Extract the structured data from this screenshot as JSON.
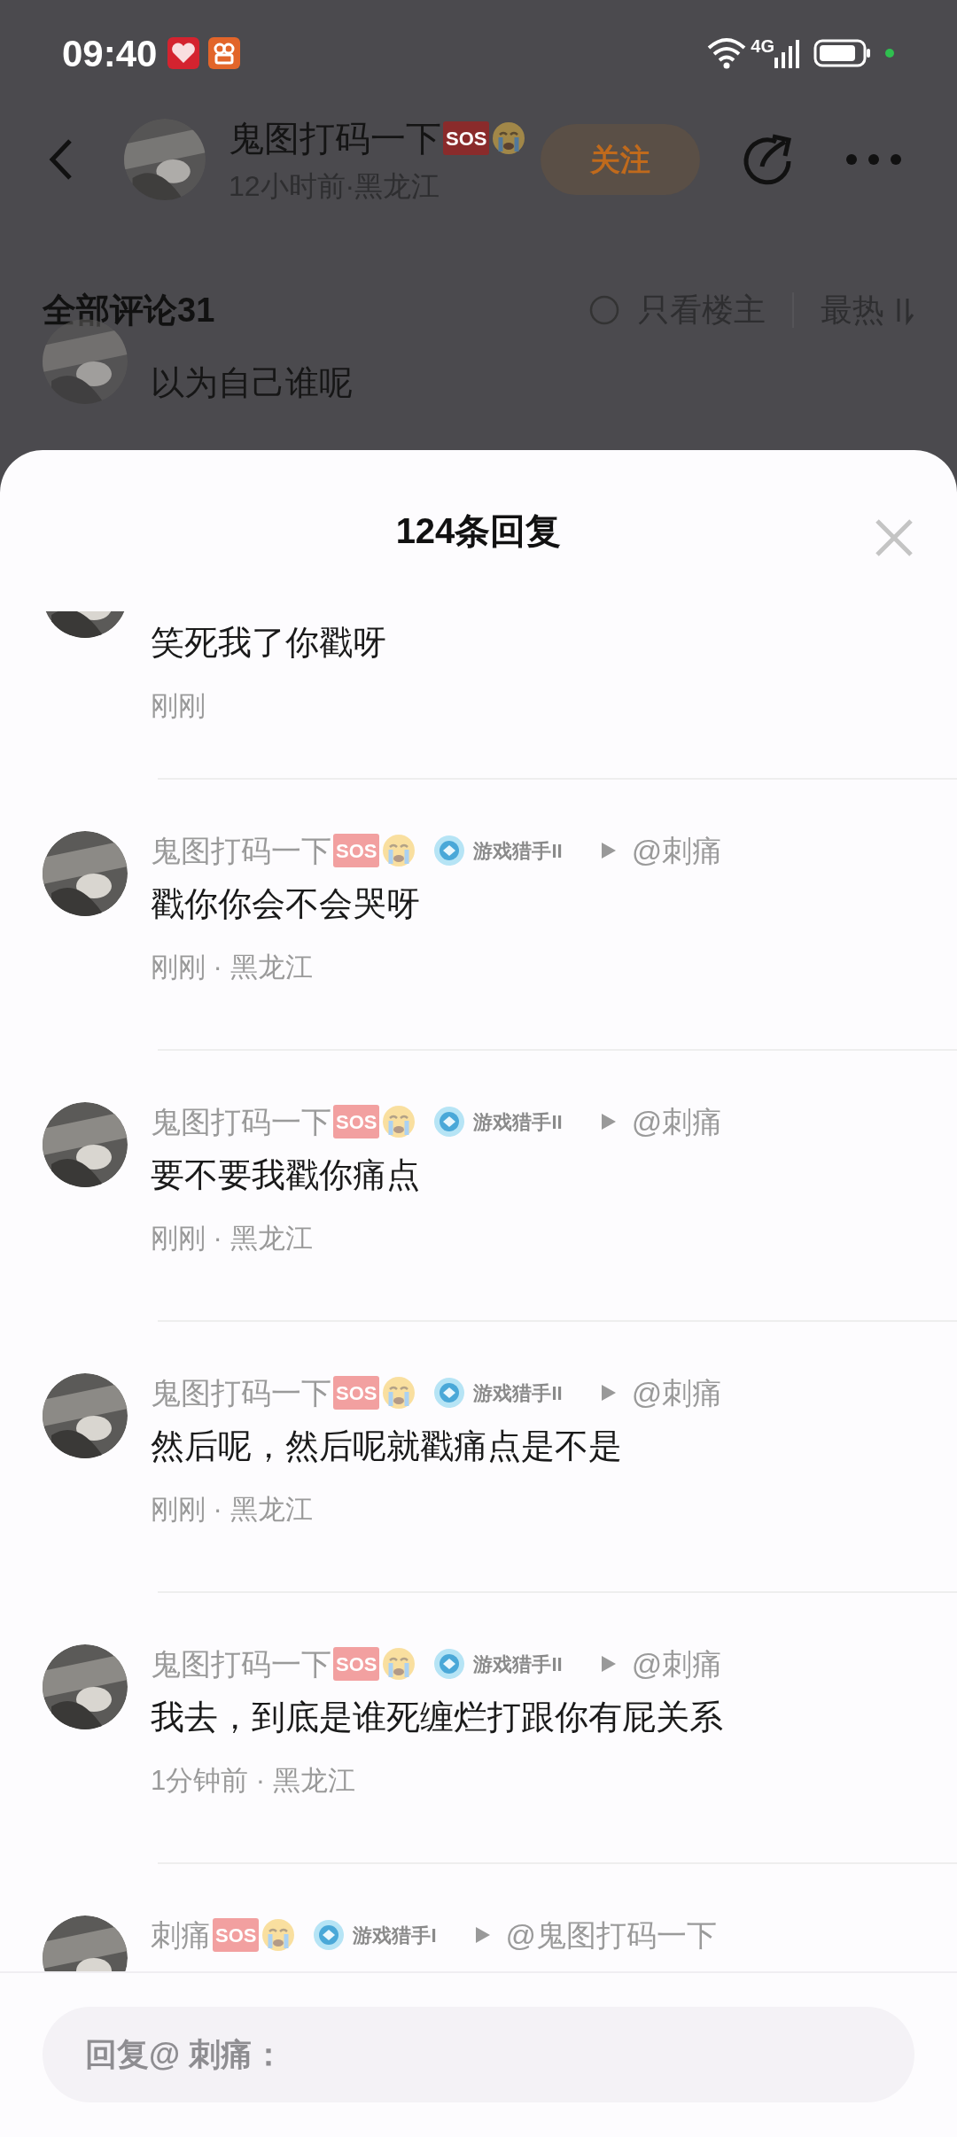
{
  "status_bar": {
    "time": "09:40",
    "network": "4G"
  },
  "post_header": {
    "author": "鬼图打码一下",
    "sos": "SOS",
    "meta": "12小时前·黑龙江",
    "follow": "关注"
  },
  "comments_header": {
    "title": "全部评论31",
    "op_only": {
      "label": "只看楼主",
      "checked": false
    },
    "sort": "最热"
  },
  "background_comment": {
    "text": "以为自己谁呢"
  },
  "sheet": {
    "title": "124条回复",
    "replies": [
      {
        "text": "笑死我了你戳呀",
        "meta": "刚刚"
      },
      {
        "author": "鬼图打码一下",
        "sos": "SOS",
        "badge": "游戏猎手II",
        "reply_to": "@刺痛",
        "text": "戳你你会不会哭呀",
        "meta": "刚刚 · 黑龙江"
      },
      {
        "author": "鬼图打码一下",
        "sos": "SOS",
        "badge": "游戏猎手II",
        "reply_to": "@刺痛",
        "text": "要不要我戳你痛点",
        "meta": "刚刚 · 黑龙江"
      },
      {
        "author": "鬼图打码一下",
        "sos": "SOS",
        "badge": "游戏猎手II",
        "reply_to": "@刺痛",
        "text": "然后呢，然后呢就戳痛点是不是",
        "meta": "刚刚 · 黑龙江"
      },
      {
        "author": "鬼图打码一下",
        "sos": "SOS",
        "badge": "游戏猎手II",
        "reply_to": "@刺痛",
        "text": "我去，到底是谁死缠烂打跟你有屁关系",
        "meta": "1分钟前 · 黑龙江"
      },
      {
        "author": "刺痛",
        "badge": "游戏猎手I",
        "reply_to": "@鬼图打码一下",
        "sos": "SOS"
      }
    ],
    "input": {
      "placeholder": "回复@ 刺痛："
    }
  }
}
